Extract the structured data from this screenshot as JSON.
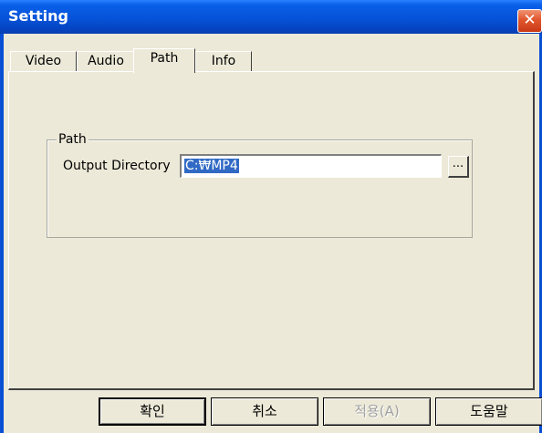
{
  "window": {
    "title": "Setting",
    "close_glyph": "✕",
    "close_icon": "close-icon"
  },
  "tabs": [
    {
      "label": "Video",
      "active": false
    },
    {
      "label": "Audio",
      "active": false
    },
    {
      "label": "Path",
      "active": true
    },
    {
      "label": "Info",
      "active": false
    }
  ],
  "path_group": {
    "legend": "Path",
    "output_label": "Output Directory",
    "output_value": "C:\\MP4",
    "output_display": "C:₩MP4",
    "browse_label": "..."
  },
  "buttons": {
    "ok": "확인",
    "cancel": "취소",
    "apply": "적용(A)",
    "help": "도움말"
  },
  "colors": {
    "titlebar": "#0653d8",
    "dialog_bg": "#ece9d8",
    "selection": "#316ac5",
    "close_button": "#e0552c"
  }
}
